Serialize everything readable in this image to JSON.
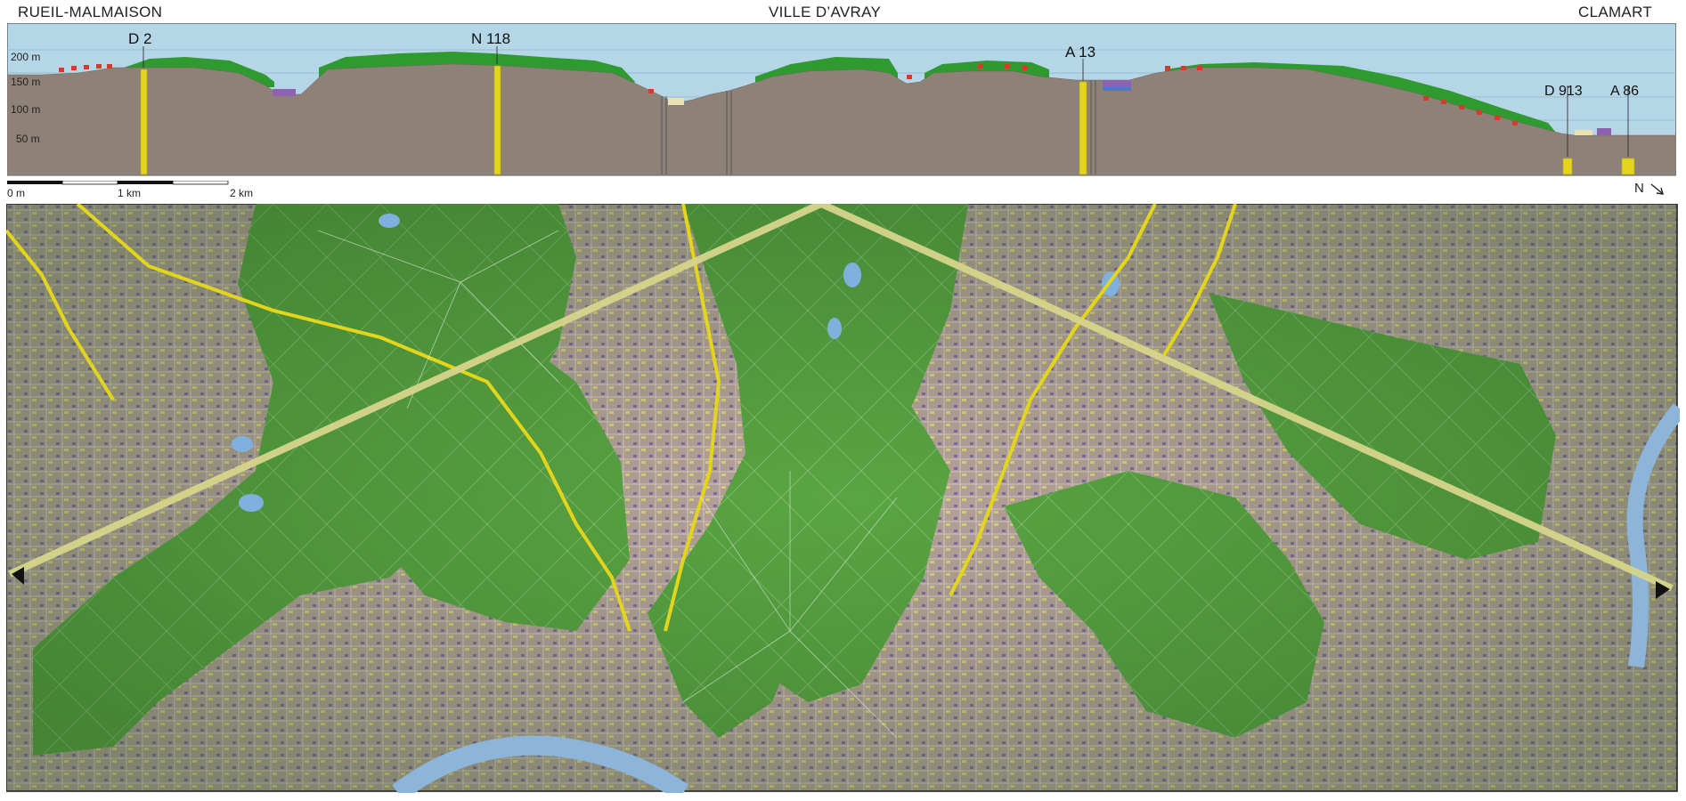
{
  "places": {
    "left": "RUEIL-MALMAISON",
    "center": "VILLE D’AVRAY",
    "right": "CLAMART"
  },
  "profile": {
    "altitude_labels": [
      "200 m",
      "150 m",
      "100 m",
      "50 m"
    ],
    "roads": [
      "D 2",
      "N 118",
      "A 13",
      "D 913",
      "A 86"
    ]
  },
  "scale": {
    "labels": [
      "0 m",
      "1 km",
      "2 km"
    ]
  },
  "north_label": "N",
  "colors": {
    "sky": "#b5d6e6",
    "terrain": "#8e8278",
    "vegetation": "#2f9a2f",
    "road_marker": "#e2d51c",
    "forest_map": "#5aa543",
    "urban": "#b49a94",
    "river": "#8db5d9",
    "section_line": "#d6d58a"
  }
}
